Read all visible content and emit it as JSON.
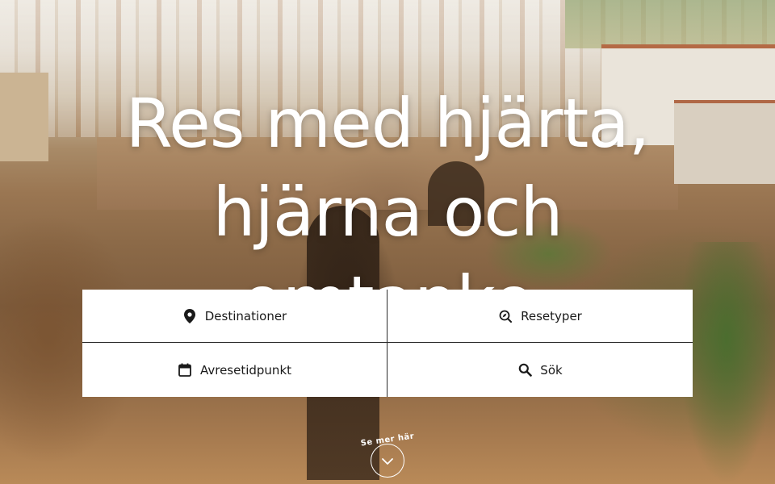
{
  "hero": {
    "headline_lines": [
      "Res med hjärta,",
      "hjärna och",
      "omtanke"
    ]
  },
  "search": {
    "destinations_label": "Destinationer",
    "destinations_icon": "map-pin-icon",
    "trip_types_label": "Resetyper",
    "trip_types_icon": "compass-search-icon",
    "departure_label": "Avresetidpunkt",
    "departure_icon": "calendar-icon",
    "search_label": "Sök",
    "search_icon": "magnifier-icon"
  },
  "scroll_hint": {
    "label": "Se mer här",
    "icon": "chevron-down-icon"
  },
  "colors": {
    "panel_bg": "#ffffff",
    "panel_text": "#1a1a1a",
    "headline": "#ffffff"
  }
}
